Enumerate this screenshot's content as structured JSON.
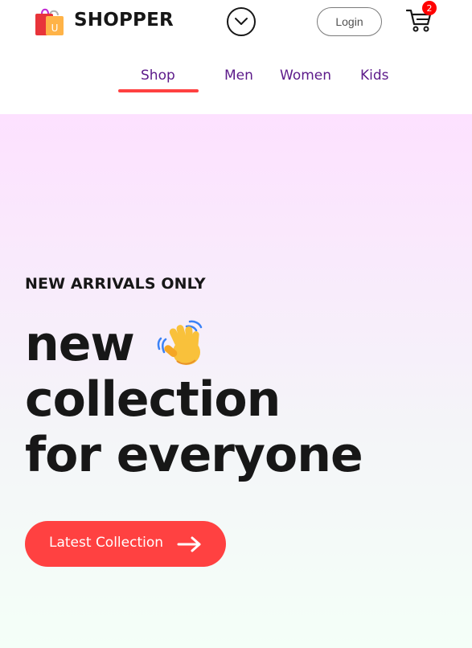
{
  "header": {
    "brand": "SHOPPER",
    "logo_letter": "U",
    "login_label": "Login",
    "cart_count": "2"
  },
  "nav": {
    "items": [
      {
        "label": "Shop",
        "active": true
      },
      {
        "label": "Men",
        "active": false
      },
      {
        "label": "Women",
        "active": false
      },
      {
        "label": "Kids",
        "active": false
      }
    ]
  },
  "hero": {
    "eyebrow": "NEW ARRIVALS ONLY",
    "line1": "new",
    "line2": "collection",
    "line3": "for everyone",
    "cta_label": "Latest Collection"
  },
  "icons": {
    "logo": "shopping-bag-icon",
    "dropdown": "chevron-down-icon",
    "cart": "shopping-cart-icon",
    "wave": "waving-hand-icon",
    "cta": "arrow-right-icon"
  },
  "colors": {
    "accent": "#ff4141",
    "nav_text": "#5c1a8a",
    "badge": "#ff0000",
    "hero_top": "#fde1ff",
    "hero_bottom": "#f4fff8",
    "text_dark": "#171717"
  }
}
